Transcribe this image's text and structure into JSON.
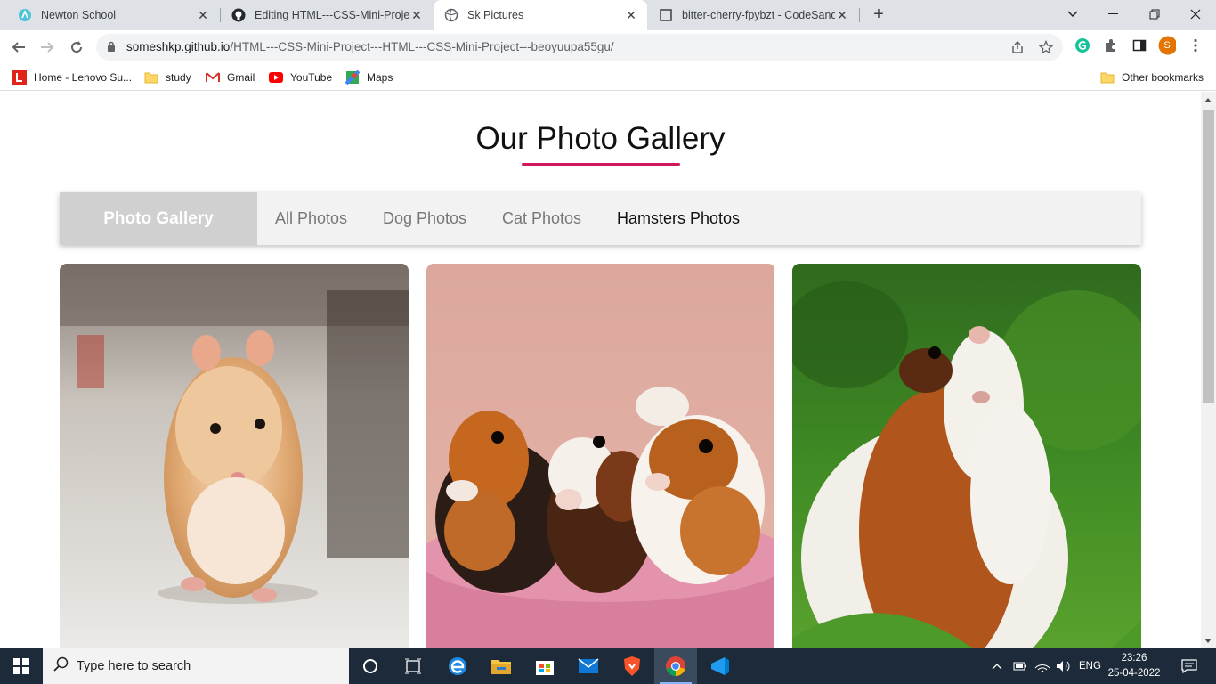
{
  "browser": {
    "tabs": [
      {
        "title": "Newton School",
        "active": false
      },
      {
        "title": "Editing HTML---CSS-Mini-Project",
        "active": false
      },
      {
        "title": "Sk Pictures",
        "active": true
      },
      {
        "title": "bitter-cherry-fpybzt - CodeSandbox",
        "active": false
      }
    ],
    "url_host": "someshkp.github.io",
    "url_path": "/HTML---CSS-Mini-Project---HTML---CSS-Mini-Project---beoyuupa55gu/",
    "profile_initial": "S",
    "bookmarks": [
      "Home - Lenovo Su...",
      "study",
      "Gmail",
      "YouTube",
      "Maps"
    ],
    "other_bookmarks": "Other bookmarks"
  },
  "page": {
    "title": "Our Photo Gallery",
    "accent_color": "#d1185d",
    "nav": {
      "brand": "Photo Gallery",
      "links": [
        "All Photos",
        "Dog Photos",
        "Cat Photos",
        "Hamsters Photos"
      ],
      "active_link": "Hamsters Photos"
    },
    "cards": [
      {
        "subject": "hamster"
      },
      {
        "subject": "three guinea pigs"
      },
      {
        "subject": "guinea pig on grass"
      }
    ]
  },
  "taskbar": {
    "search_placeholder": "Type here to search",
    "language": "ENG",
    "time": "23:26",
    "date": "25-04-2022"
  }
}
